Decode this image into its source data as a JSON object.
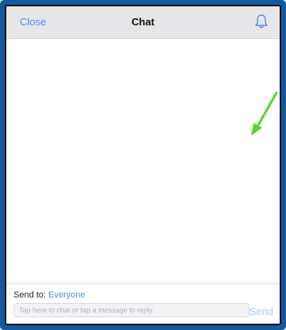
{
  "header": {
    "close_label": "Close",
    "title": "Chat",
    "bell_icon": "bell-icon"
  },
  "footer": {
    "send_to_label": "Send to:",
    "recipient": "Everyone",
    "input_placeholder": "Tap here to chat or tap a message to reply",
    "send_label": "Send"
  },
  "colors": {
    "accent": "#4a90e2",
    "header_bg": "#e7e7ea",
    "frame": "#0f5aa0",
    "annotation_arrow": "#58d336"
  }
}
